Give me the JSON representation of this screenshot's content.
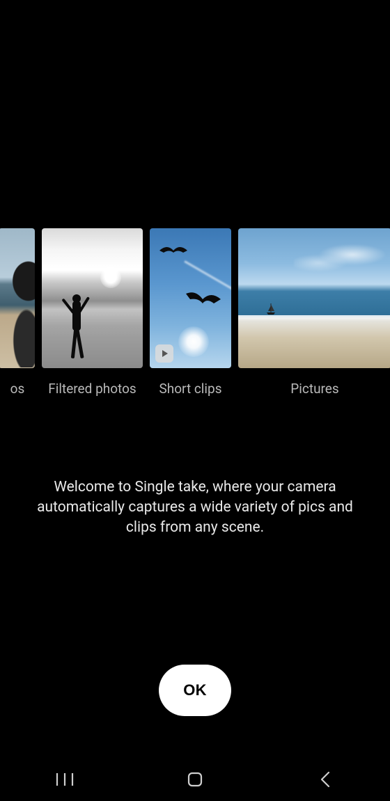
{
  "carousel": {
    "items": [
      {
        "label": "os",
        "kind": "photo-color-beach-person",
        "partial": true
      },
      {
        "label": "Filtered photos",
        "kind": "photo-bw-beach-person"
      },
      {
        "label": "Short clips",
        "kind": "video-sky-birds",
        "has_play_badge": true
      },
      {
        "label": "Pictures",
        "kind": "photo-color-beach-sailboat"
      }
    ]
  },
  "welcome_text": "Welcome to Single take, where your camera automatically captures a wide variety of pics and clips from any scene.",
  "ok_label": "OK",
  "nav": {
    "recents_icon": "recents",
    "home_icon": "home",
    "back_icon": "back"
  },
  "colors": {
    "background": "#000000",
    "text_muted": "#b9b9b9",
    "text_body": "#e9e9e9",
    "button_bg": "#ffffff",
    "button_fg": "#000000"
  }
}
